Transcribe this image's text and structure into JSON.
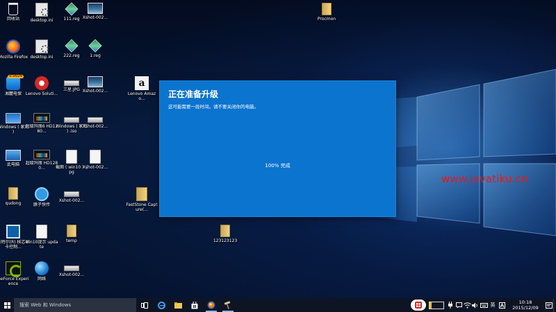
{
  "desktop": {
    "icons": [
      {
        "label": "回收站",
        "glyph": "bin"
      },
      {
        "label": "desktop.ini",
        "glyph": "gear"
      },
      {
        "label": "111.reg",
        "glyph": "reg"
      },
      {
        "label": "Xshot-002...",
        "glyph": "thumb"
      },
      {
        "label": "Procmon",
        "glyph": "folder"
      },
      {
        "label": "Mozilla Firefox",
        "glyph": "firefox"
      },
      {
        "label": "desktop.ini",
        "glyph": "gear"
      },
      {
        "label": "222.reg",
        "glyph": "reg"
      },
      {
        "label": "1.reg",
        "glyph": "reg"
      },
      {
        "label": "湘麓电保",
        "glyph": "shield",
        "badge": "0.0026"
      },
      {
        "label": "Lenovo Soluti...",
        "glyph": "lenovo"
      },
      {
        "label": "三星.JPG",
        "glyph": "iso"
      },
      {
        "label": "Xshot-002...",
        "glyph": "thumb"
      },
      {
        "label": "Lenovo Amazo...",
        "glyph": "amazon"
      },
      {
        "label": "Windows ( 家庭 )",
        "glyph": "win"
      },
      {
        "label": "超级玛丽6 HD1280...",
        "glyph": "video"
      },
      {
        "label": "Windows ( 家庭 ) .iso",
        "glyph": "iso"
      },
      {
        "label": "Xshot-002...",
        "glyph": "iso"
      },
      {
        "label": "此电脑",
        "glyph": "pc"
      },
      {
        "label": "超级玛丽 HD1280...",
        "glyph": "video"
      },
      {
        "label": "截图 ( win10 ) .jpg",
        "glyph": "doc"
      },
      {
        "label": "Xshot-002...",
        "glyph": "doc"
      },
      {
        "label": "qudong",
        "glyph": "folder"
      },
      {
        "label": "豚子快传",
        "glyph": "fish"
      },
      {
        "label": "Xshot-002...",
        "glyph": "iso"
      },
      {
        "label": "FastStone Capture(...",
        "glyph": "fsc"
      },
      {
        "label": "英特尔(R) 核芯显卡控制...",
        "glyph": "cpu"
      },
      {
        "label": "win10提示 update",
        "glyph": "doc"
      },
      {
        "label": "temp",
        "glyph": "folder"
      },
      {
        "label": "123123123",
        "glyph": "folder"
      },
      {
        "label": "GeForce Experience",
        "glyph": "nvidia"
      },
      {
        "label": "网络",
        "glyph": "globe"
      },
      {
        "label": "Xshot-002...",
        "glyph": "iso"
      }
    ]
  },
  "dialog": {
    "title": "正在准备升级",
    "subtitle": "这可能需要一段时间。请不要关闭你的电脑。",
    "progress_text": "100% 完成",
    "background": "#0b74cf"
  },
  "watermark": "www.javatiku.cn",
  "taskbar": {
    "search_placeholder": "搜索 Web 和 Windows",
    "apps": [
      {
        "name": "task-view",
        "icon": "task-view-icon"
      },
      {
        "name": "edge",
        "icon": "edge-icon"
      },
      {
        "name": "file-explorer",
        "icon": "folder-icon"
      },
      {
        "name": "store",
        "icon": "store-icon"
      },
      {
        "name": "firefox",
        "icon": "firefox-icon"
      },
      {
        "name": "setup",
        "icon": "hammer-icon"
      }
    ],
    "tray": {
      "battery_percent": "15%",
      "battery_level": 0.15,
      "ime": "英",
      "time": "10:18",
      "date": "2015/12/09"
    }
  }
}
